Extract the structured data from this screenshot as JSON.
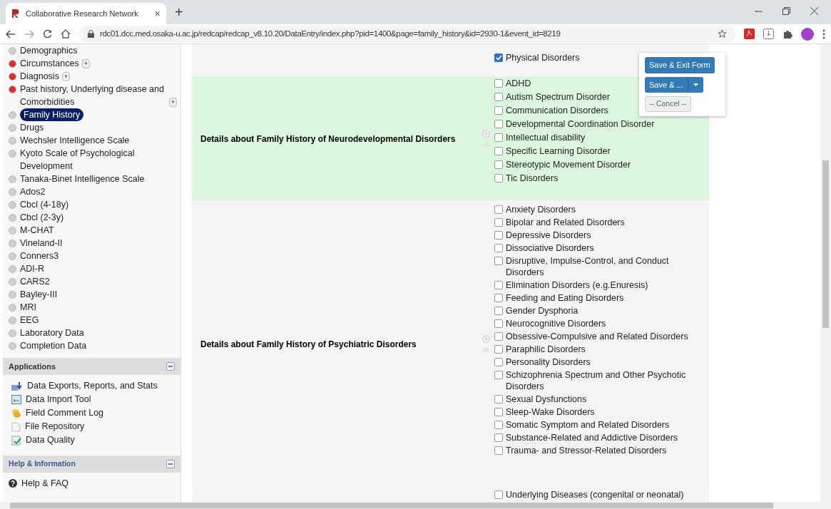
{
  "browser": {
    "tab_title": "Collaborative Research Network",
    "tab_close": "×",
    "new_tab": "+",
    "url": "rdc01.dcc.med.osaka-u.ac.jp/redcap/redcap_v8.10.20/DataEntry/index.php?pid=1400&page=family_history&id=2930-1&event_id=8219"
  },
  "sidebar": {
    "instruments": [
      {
        "label": "Demographics",
        "color": "#cfcfcf",
        "selected": false
      },
      {
        "label": "Circumstances",
        "color": "#d9312a",
        "selected": false,
        "expand": "+"
      },
      {
        "label": "Diagnosis",
        "color": "#d9312a",
        "selected": false,
        "expand": "+"
      },
      {
        "label": "Past history, Underlying disease and Comorbidities",
        "color": "#d9312a",
        "selected": false,
        "expand": "+"
      },
      {
        "label": "Family History",
        "color": "#cfcfcf",
        "selected": true
      },
      {
        "label": "Drugs",
        "color": "#cfcfcf",
        "selected": false
      },
      {
        "label": "Wechsler Intelligence Scale",
        "color": "#cfcfcf",
        "selected": false
      },
      {
        "label": "Kyoto Scale of Psychological Development",
        "color": "#cfcfcf",
        "selected": false
      },
      {
        "label": "Tanaka-Binet Intelligence Scale",
        "color": "#cfcfcf",
        "selected": false
      },
      {
        "label": "Ados2",
        "color": "#cfcfcf",
        "selected": false
      },
      {
        "label": "Cbcl (4-18y)",
        "color": "#cfcfcf",
        "selected": false
      },
      {
        "label": "Cbcl (2-3y)",
        "color": "#cfcfcf",
        "selected": false
      },
      {
        "label": "M-CHAT",
        "color": "#cfcfcf",
        "selected": false
      },
      {
        "label": "Vineland-II",
        "color": "#cfcfcf",
        "selected": false
      },
      {
        "label": "Conners3",
        "color": "#cfcfcf",
        "selected": false
      },
      {
        "label": "ADI-R",
        "color": "#cfcfcf",
        "selected": false
      },
      {
        "label": "CARS2",
        "color": "#cfcfcf",
        "selected": false
      },
      {
        "label": "Bayley-III",
        "color": "#cfcfcf",
        "selected": false
      },
      {
        "label": "MRI",
        "color": "#cfcfcf",
        "selected": false
      },
      {
        "label": "EEG",
        "color": "#cfcfcf",
        "selected": false
      },
      {
        "label": "Laboratory Data",
        "color": "#cfcfcf",
        "selected": false
      },
      {
        "label": "Completion Data",
        "color": "#cfcfcf",
        "selected": false
      }
    ],
    "applications": {
      "title": "Applications",
      "items": [
        {
          "label": "Data Exports, Reports, and Stats",
          "kind": "export"
        },
        {
          "label": "Data Import Tool",
          "kind": "import"
        },
        {
          "label": "Field Comment Log",
          "kind": "comment"
        },
        {
          "label": "File Repository",
          "kind": "file"
        },
        {
          "label": "Data Quality",
          "kind": "quality"
        }
      ]
    },
    "help": {
      "title": "Help & Information",
      "items": [
        {
          "label": "Help & FAQ",
          "kind": "help"
        }
      ]
    }
  },
  "form": {
    "rows": [
      {
        "highlighted": false,
        "options": [
          {
            "label": "Physical Disorders",
            "checked": true
          }
        ]
      },
      {
        "label": "Details about Family History of Neurodevelopmental Disorders",
        "highlighted": true,
        "options": [
          {
            "label": "ADHD",
            "checked": false
          },
          {
            "label": "Autism Spectrum Disorder",
            "checked": false
          },
          {
            "label": "Communication Disorders",
            "checked": false
          },
          {
            "label": "Developmental Coordination Disorder",
            "checked": false
          },
          {
            "label": "Intellectual disability",
            "checked": false
          },
          {
            "label": "Specific Learning Disorder",
            "checked": false
          },
          {
            "label": "Stereotypic Movement Disorder",
            "checked": false
          },
          {
            "label": "Tic Disorders",
            "checked": false
          }
        ]
      },
      {
        "label": "Details about Family History of Psychiatric Disorders",
        "highlighted": false,
        "options": [
          {
            "label": "Anxiety Disorders",
            "checked": false
          },
          {
            "label": "Bipolar and Related Disorders",
            "checked": false
          },
          {
            "label": "Depressive Disorders",
            "checked": false
          },
          {
            "label": "Dissociative Disorders",
            "checked": false
          },
          {
            "label": "Disruptive, Impulse-Control, and Conduct Disorders",
            "checked": false
          },
          {
            "label": "Elimination Disorders (e.g.Enuresis)",
            "checked": false
          },
          {
            "label": "Feeding and Eating Disorders",
            "checked": false
          },
          {
            "label": "Gender Dysphoria",
            "checked": false
          },
          {
            "label": "Neurocognitive Disorders",
            "checked": false
          },
          {
            "label": "Obsessive-Compulsive and Related Disorders",
            "checked": false
          },
          {
            "label": "Paraphilic Disorders",
            "checked": false
          },
          {
            "label": "Personality Disorders",
            "checked": false
          },
          {
            "label": "Schizophrenia Spectrum and Other Psychotic Disorders",
            "checked": false
          },
          {
            "label": "Sexual Dysfunctions",
            "checked": false
          },
          {
            "label": "Sleep-Wake Disorders",
            "checked": false
          },
          {
            "label": "Somatic Symptom and Related Disorders",
            "checked": false
          },
          {
            "label": "Substance-Related and Addictive Disorders",
            "checked": false
          },
          {
            "label": "Trauma- and Stressor-Related Disorders",
            "checked": false
          }
        ]
      },
      {
        "highlighted": false,
        "options": [
          {
            "label": "Underlying Diseases (congenital or neonatal)",
            "checked": false
          }
        ]
      }
    ]
  },
  "save_panel": {
    "buttons": [
      {
        "label": "Save & Exit Form",
        "kind": "primary"
      },
      {
        "label": "Save & ...",
        "kind": "split"
      },
      {
        "label": "-- Cancel --",
        "kind": "secondary"
      }
    ]
  }
}
